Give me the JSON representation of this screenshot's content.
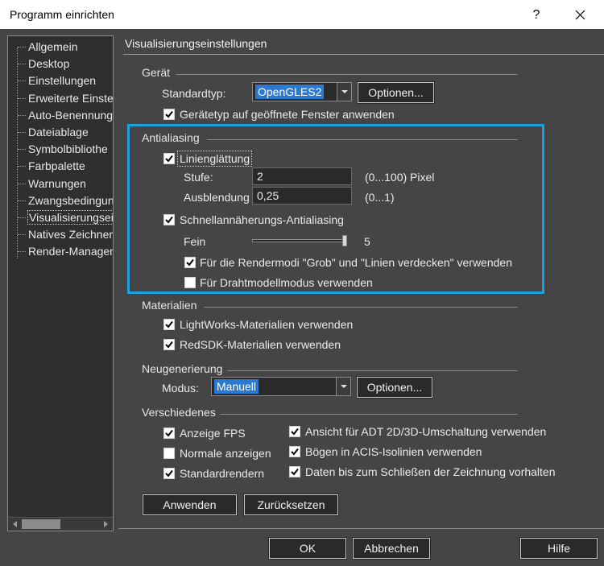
{
  "window": {
    "title": "Programm einrichten",
    "help": "?"
  },
  "sidebar": {
    "items": [
      {
        "label": "Allgemein"
      },
      {
        "label": "Desktop"
      },
      {
        "label": "Einstellungen"
      },
      {
        "label": "Erweiterte Einste"
      },
      {
        "label": "Auto-Benennung"
      },
      {
        "label": "Dateiablage"
      },
      {
        "label": "Symbolbibliothe"
      },
      {
        "label": "Farbpalette"
      },
      {
        "label": "Warnungen"
      },
      {
        "label": "Zwangsbedingun"
      },
      {
        "label": "Visualisierungsei"
      },
      {
        "label": "Natives Zeichner"
      },
      {
        "label": "Render-Manager"
      }
    ],
    "selected_index": 10
  },
  "panel": {
    "title": "Visualisierungseinstellungen",
    "geraet": {
      "group": "Gerät",
      "standardtyp_label": "Standardtyp:",
      "standardtyp_value": "OpenGLES2",
      "optionen": "Optionen...",
      "apply_type_label": "Gerätetyp auf geöffnete Fenster anwenden",
      "apply_type_checked": true
    },
    "antialiasing": {
      "group": "Antialiasing",
      "linienglaettung_label": "Linienglättung",
      "linienglaettung_checked": true,
      "stufe_label": "Stufe:",
      "stufe_value": "2",
      "stufe_hint": "(0...100) Pixel",
      "ausblendung_label": "Ausblendung",
      "ausblendung_value": "0,25",
      "ausblendung_hint": "(0...1)",
      "schnell_label": "Schnellannäherungs-Antialiasing",
      "schnell_checked": true,
      "fein_label": "Fein",
      "fein_value": "5",
      "fein_fraction": 1.0,
      "rendermodi_label": "Für die Rendermodi \"Grob\" und \"Linien verdecken\" verwenden",
      "rendermodi_checked": true,
      "draht_label": "Für Drahtmodellmodus verwenden",
      "draht_checked": false
    },
    "materialien": {
      "group": "Materialien",
      "lightworks_label": "LightWorks-Materialien verwenden",
      "lightworks_checked": true,
      "redsdk_label": "RedSDK-Materialien verwenden",
      "redsdk_checked": true
    },
    "neugenerierung": {
      "group": "Neugenerierung",
      "modus_label": "Modus:",
      "modus_value": "Manuell",
      "optionen": "Optionen..."
    },
    "verschiedenes": {
      "group": "Verschiedenes",
      "fps_label": "Anzeige FPS",
      "fps_checked": true,
      "normale_label": "Normale anzeigen",
      "normale_checked": false,
      "standardrendern_label": "Standardrendern",
      "standardrendern_checked": true,
      "adt_label": "Ansicht für ADT 2D/3D-Umschaltung verwenden",
      "adt_checked": true,
      "boegen_label": "Bögen in ACIS-Isolinien verwenden",
      "boegen_checked": true,
      "daten_label": "Daten bis zum Schließen der Zeichnung vorhalten",
      "daten_checked": true
    },
    "anwenden": "Anwenden",
    "zuruecksetzen": "Zurücksetzen"
  },
  "footer": {
    "ok": "OK",
    "abbrechen": "Abbrechen",
    "hilfe": "Hilfe"
  }
}
